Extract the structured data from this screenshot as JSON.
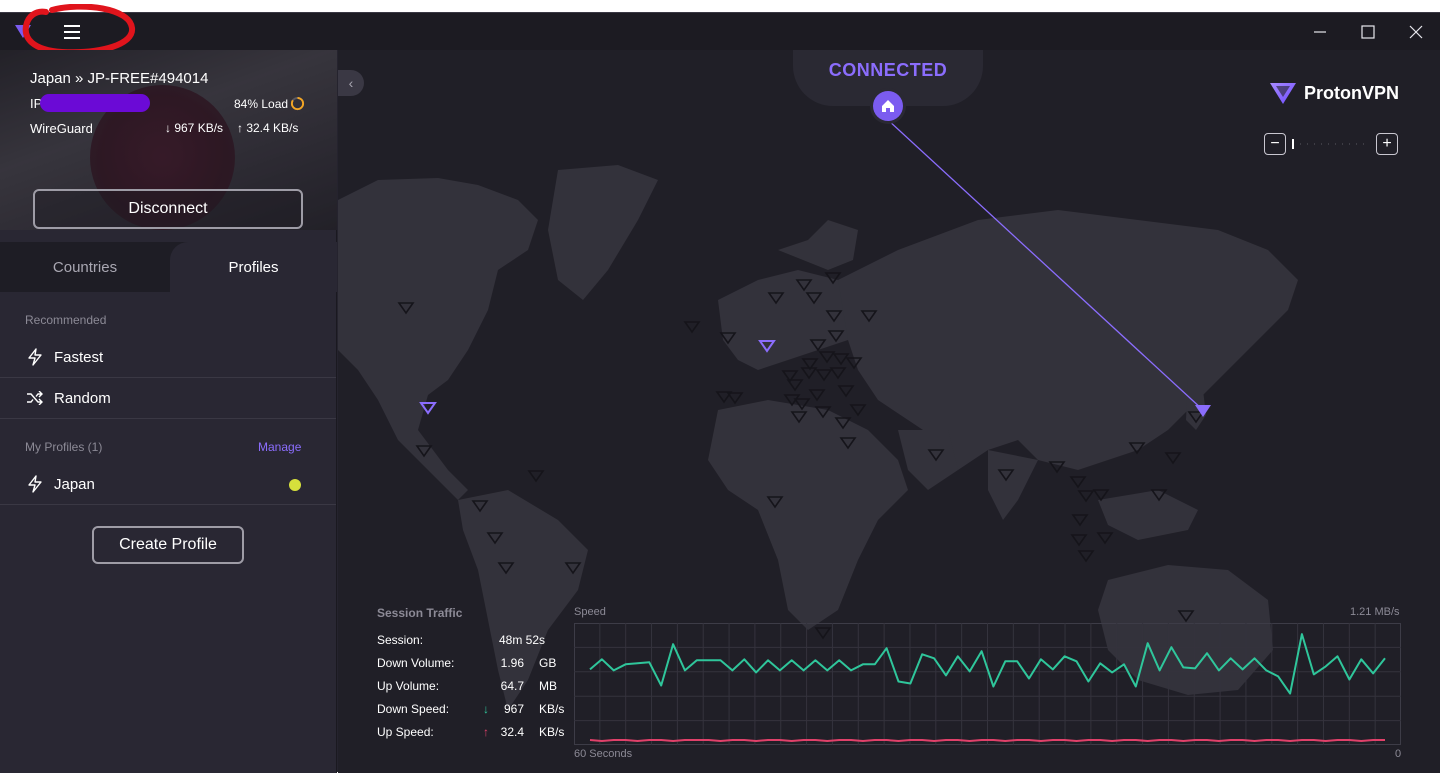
{
  "titlebar": {
    "minimize_icon": "minimize-icon",
    "maximize_icon": "maximize-icon",
    "close_icon": "close-icon",
    "menu_icon": "hamburger-menu-icon"
  },
  "connection": {
    "server": "Japan » JP-FREE#494014",
    "ip_label": "IP",
    "load": "84% Load",
    "load_fraction": 0.84,
    "protocol": "WireGuard",
    "down_speed": "↓ 967 KB/s",
    "up_speed": "↑ 32.4 KB/s",
    "disconnect_label": "Disconnect"
  },
  "tabs": {
    "countries": "Countries",
    "profiles": "Profiles",
    "active": "Profiles"
  },
  "profiles": {
    "recommended_header": "Recommended",
    "fastest": "Fastest",
    "random": "Random",
    "my_profiles_header": "My Profiles (1)",
    "manage": "Manage",
    "japan": "Japan",
    "japan_color": "#d6e03c",
    "create_profile": "Create Profile"
  },
  "map": {
    "status": "CONNECTED",
    "brand": "ProtonVPN",
    "zoom_out": "−",
    "zoom_in": "+",
    "collapse": "‹",
    "accent": "#8b6dfd"
  },
  "traffic": {
    "title": "Session Traffic",
    "rows": [
      {
        "key": "Session:",
        "value": "48m 52s",
        "unit": ""
      },
      {
        "key": "Down Volume:",
        "value": "1.96",
        "unit": "GB"
      },
      {
        "key": "Up Volume:",
        "value": "64.7",
        "unit": "MB"
      },
      {
        "key": "Down Speed:",
        "value": "967",
        "unit": "KB/s"
      },
      {
        "key": "Up Speed:",
        "value": "32.4",
        "unit": "KB/s"
      }
    ],
    "down_arrow": "↓",
    "up_arrow": "↑",
    "down_color": "#2fc69b",
    "up_color": "#e0416a"
  },
  "chart_data": {
    "type": "line",
    "title": "Speed",
    "max_label": "1.21 MB/s",
    "ylim": [
      0,
      1.21
    ],
    "x_start_label": "60 Seconds",
    "x_end_label": "0",
    "series": [
      {
        "color": "#2fc69b",
        "values": [
          0.75,
          0.85,
          0.74,
          0.8,
          0.81,
          0.82,
          0.59,
          1.0,
          0.74,
          0.84,
          0.84,
          0.84,
          0.74,
          0.85,
          0.72,
          0.84,
          0.74,
          0.84,
          0.74,
          0.84,
          0.74,
          0.84,
          0.74,
          0.8,
          0.8,
          0.96,
          0.63,
          0.61,
          0.9,
          0.86,
          0.69,
          0.88,
          0.73,
          0.93,
          0.58,
          0.83,
          0.83,
          0.66,
          0.85,
          0.75,
          0.88,
          0.83,
          0.63,
          0.81,
          0.72,
          0.8,
          0.58,
          1.01,
          0.74,
          0.97,
          0.77,
          0.76,
          0.91,
          0.74,
          0.86,
          0.75,
          0.86,
          0.74,
          0.68,
          0.51,
          1.1,
          0.7,
          0.78,
          0.88,
          0.65,
          0.85,
          0.71,
          0.86
        ]
      },
      {
        "color": "#e0416a",
        "values": [
          0.05,
          0.04,
          0.05,
          0.05,
          0.04,
          0.05,
          0.05,
          0.04,
          0.05,
          0.05,
          0.05,
          0.04,
          0.05,
          0.05,
          0.04,
          0.05,
          0.05,
          0.04,
          0.05,
          0.05,
          0.04,
          0.05,
          0.05,
          0.04,
          0.05,
          0.05,
          0.04,
          0.05,
          0.05,
          0.04,
          0.05,
          0.05,
          0.04,
          0.05,
          0.05,
          0.04,
          0.05,
          0.05,
          0.04,
          0.05,
          0.05,
          0.04,
          0.05,
          0.05,
          0.04,
          0.05,
          0.05,
          0.04,
          0.05,
          0.05,
          0.04,
          0.05,
          0.05,
          0.04,
          0.05,
          0.05,
          0.04,
          0.05,
          0.05,
          0.04,
          0.05,
          0.05,
          0.04,
          0.05,
          0.05,
          0.04,
          0.05,
          0.05
        ]
      }
    ]
  }
}
